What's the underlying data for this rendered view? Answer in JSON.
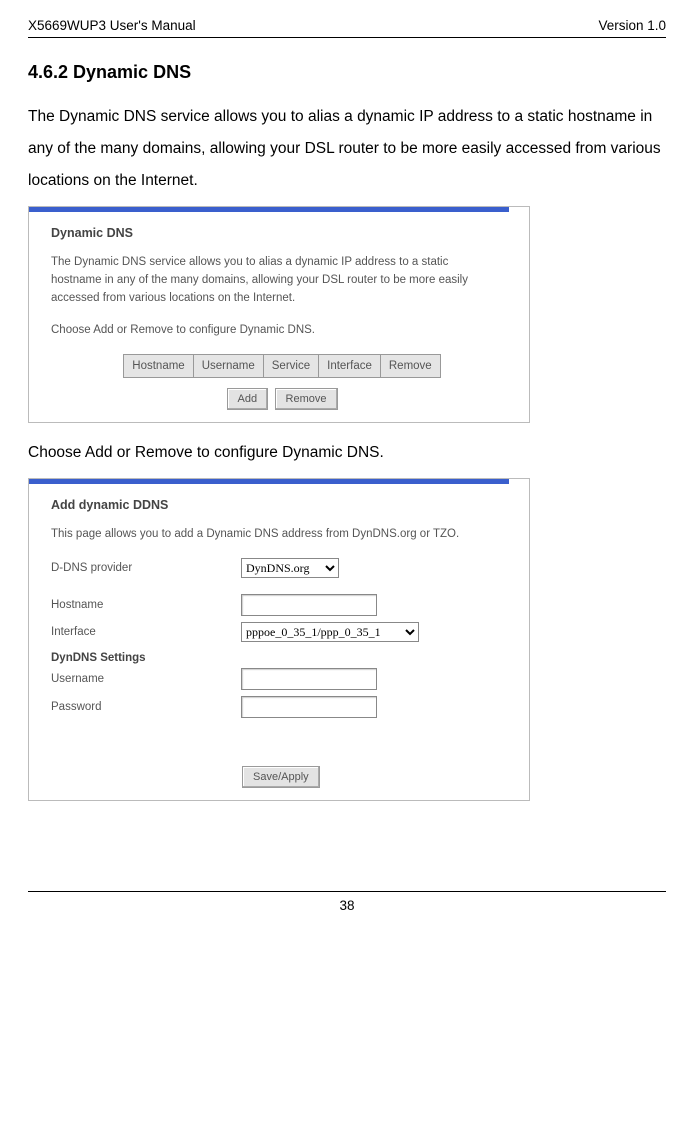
{
  "header": {
    "left": "X5669WUP3 User's Manual",
    "right": "Version 1.0"
  },
  "section_title": "4.6.2 Dynamic DNS",
  "intro": "The Dynamic DNS service allows you to alias a dynamic IP address to a static hostname in any of the many domains, allowing your DSL router to be more easily accessed from various locations on the Internet.",
  "shot1": {
    "title": "Dynamic DNS",
    "desc1": "The Dynamic DNS service allows you to alias a dynamic IP address to a static hostname in any of the many domains, allowing your DSL router to be more easily accessed from various locations on the Internet.",
    "desc2": "Choose Add or Remove to configure Dynamic DNS.",
    "cols": [
      "Hostname",
      "Username",
      "Service",
      "Interface",
      "Remove"
    ],
    "btn_add": "Add",
    "btn_remove": "Remove"
  },
  "mid_text": "Choose Add or Remove to configure Dynamic DNS.",
  "shot2": {
    "title": "Add dynamic DDNS",
    "desc": "This page allows you to add a Dynamic DNS address from DynDNS.org or TZO.",
    "label_provider": "D-DNS provider",
    "provider_value": "DynDNS.org",
    "label_hostname": "Hostname",
    "hostname_value": "",
    "label_interface": "Interface",
    "interface_value": "pppoe_0_35_1/ppp_0_35_1",
    "settings_title": "DynDNS Settings",
    "label_username": "Username",
    "username_value": "",
    "label_password": "Password",
    "password_value": "",
    "btn_save": "Save/Apply"
  },
  "footer_page": "38"
}
